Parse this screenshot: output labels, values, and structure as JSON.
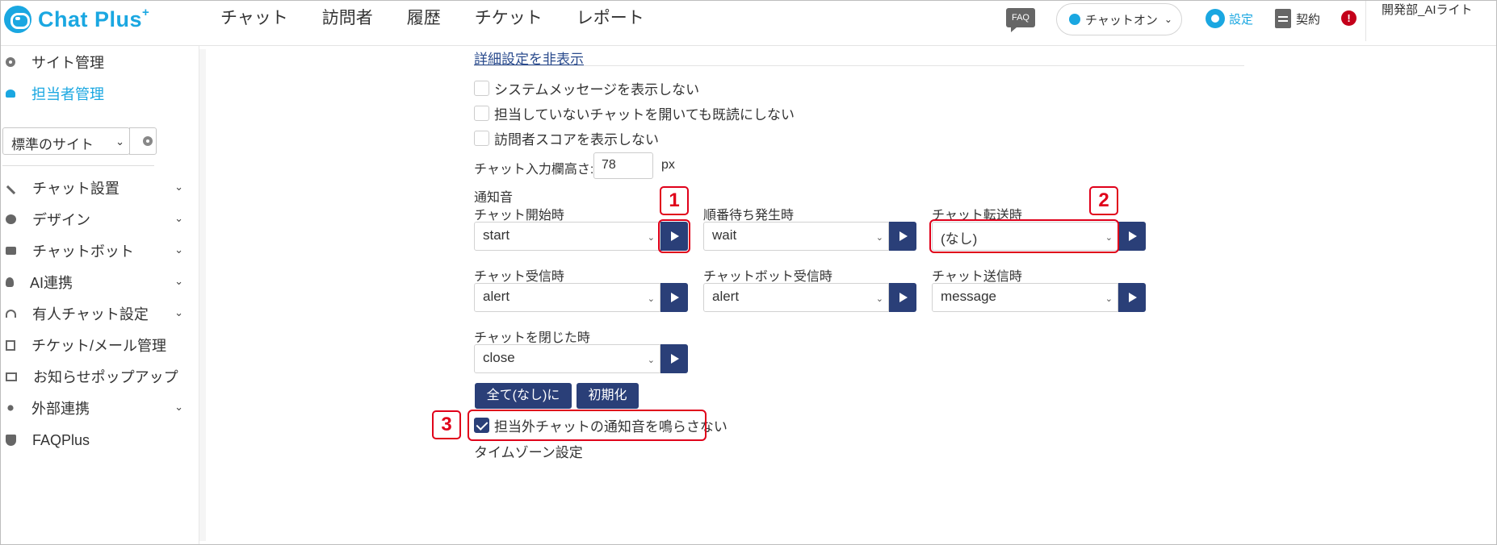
{
  "header": {
    "logo_text": "Chat Plus",
    "logo_plus": "+",
    "nav": [
      "チャット",
      "訪問者",
      "履歴",
      "チケット",
      "レポート"
    ],
    "faq_label": "FAQ",
    "chat_status": "チャットオン",
    "settings_label": "設定",
    "contract_label": "契約",
    "alert_mark": "!",
    "user_name": "開発部_AIライト"
  },
  "sidebar": {
    "top_items": [
      {
        "label": "サイト管理",
        "icon": "gear-icon"
      },
      {
        "label": "担当者管理",
        "icon": "user-icon",
        "active": true
      }
    ],
    "site_select": "標準のサイト",
    "menu": [
      {
        "label": "チャット設置",
        "icon": "tools-icon",
        "expand": true
      },
      {
        "label": "デザイン",
        "icon": "palette-icon",
        "expand": true
      },
      {
        "label": "チャットボット",
        "icon": "chat-bubble-icon",
        "expand": true
      },
      {
        "label": "AI連携",
        "icon": "bulb-icon",
        "expand": true
      },
      {
        "label": "有人チャット設定",
        "icon": "headset-icon",
        "expand": true
      },
      {
        "label": "チケット/メール管理",
        "icon": "list-icon",
        "expand": false
      },
      {
        "label": "お知らせポップアップ",
        "icon": "popup-icon",
        "expand": true
      },
      {
        "label": "外部連携",
        "icon": "share-icon",
        "expand": true
      },
      {
        "label": "FAQPlus",
        "icon": "shield-icon",
        "expand": false
      }
    ]
  },
  "main": {
    "detail_toggle": "詳細設定を非表示",
    "checkboxes": [
      {
        "label": "システムメッセージを表示しない",
        "checked": false
      },
      {
        "label": "担当していないチャットを開いても既読にしない",
        "checked": false
      },
      {
        "label": "訪問者スコアを表示しない",
        "checked": false
      }
    ],
    "input_height_label": "チャット入力欄高さ:",
    "input_height_value": "78",
    "input_height_unit": "px",
    "sound_heading": "通知音",
    "sounds": [
      {
        "label": "チャット開始時",
        "value": "start"
      },
      {
        "label": "順番待ち発生時",
        "value": "wait"
      },
      {
        "label": "チャット転送時",
        "value": "(なし)"
      },
      {
        "label": "チャット受信時",
        "value": "alert"
      },
      {
        "label": "チャットボット受信時",
        "value": "alert"
      },
      {
        "label": "チャット送信時",
        "value": "message"
      },
      {
        "label": "チャットを閉じた時",
        "value": "close"
      }
    ],
    "btn_all_none": "全て(なし)に",
    "btn_reset": "初期化",
    "mute_checkbox": {
      "label": "担当外チャットの通知音を鳴らさない",
      "checked": true
    },
    "timezone_heading": "タイムゾーン設定"
  },
  "annotations": [
    "1",
    "2",
    "3"
  ],
  "colors": {
    "brand": "#1aa7e1",
    "button": "#2a3f78",
    "annotation": "#e0001a"
  }
}
